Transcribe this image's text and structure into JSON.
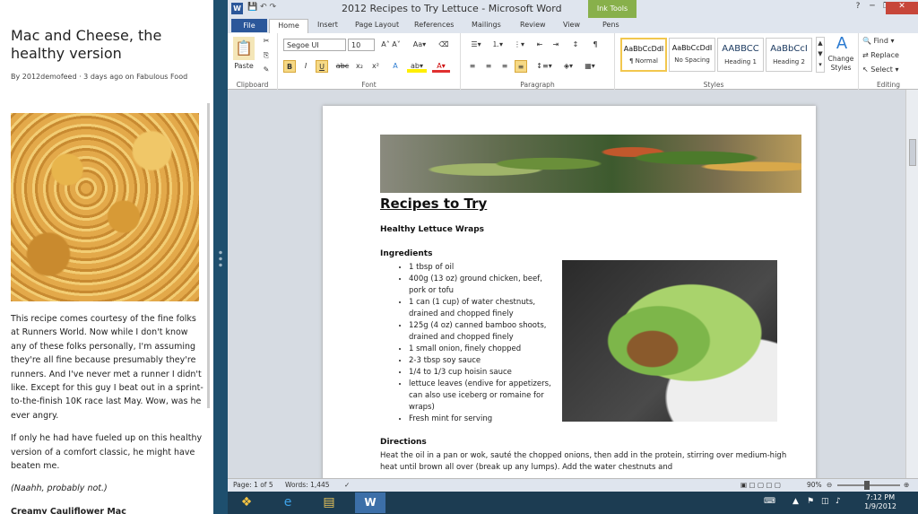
{
  "reader": {
    "title": "Mac and Cheese, the healthy version",
    "byline": "By 2012demofeed · 3 days ago on Fabulous Food",
    "paragraphs": [
      "This recipe comes courtesy of the fine folks at Runners World. Now while I don't know any of these folks personally, I'm assuming they're all fine because presumably they're runners. And I've never met a runner I didn't like. Except for this guy I beat out in a sprint-to-the-finish 10K race last May. Wow, was he ever angry.",
      "If only he had have fueled up on this healthy version of a comfort classic, he might have beaten me.",
      "(Naahh, probably not.)"
    ],
    "subheading": "Creamy Cauliflower Mac"
  },
  "word": {
    "window_title": "2012 Recipes to Try Lettuce - Microsoft Word",
    "contextual_tab": "Ink Tools",
    "tabs": [
      "File",
      "Home",
      "Insert",
      "Page Layout",
      "References",
      "Mailings",
      "Review",
      "View",
      "Pens"
    ],
    "ribbon": {
      "paste_label": "Paste",
      "font_name": "Segoe UI",
      "font_size": "10",
      "groups": [
        "Clipboard",
        "Font",
        "Paragraph",
        "Styles",
        "Editing"
      ],
      "styles": [
        {
          "preview": "AaBbCcDdI",
          "name": "¶ Normal"
        },
        {
          "preview": "AaBbCcDdI",
          "name": "No Spacing"
        },
        {
          "preview": "AABBCC",
          "name": "Heading 1"
        },
        {
          "preview": "AaBbCcI",
          "name": "Heading 2"
        }
      ],
      "change_styles": "Change Styles",
      "find": "Find",
      "replace": "Replace",
      "select": "Select"
    },
    "document": {
      "heading": "Recipes to Try",
      "recipe_title": "Healthy Lettuce Wraps",
      "ingredients_label": "Ingredients",
      "ingredients": [
        "1 tbsp of oil",
        "400g (13 oz) ground chicken, beef, pork or tofu",
        "1 can (1 cup) of water chestnuts, drained and chopped finely",
        "125g (4 oz) canned bamboo shoots, drained and chopped finely",
        "1 small onion, finely chopped",
        "2-3 tbsp soy sauce",
        "1/4 to 1/3 cup hoisin sauce",
        "lettuce leaves (endive for appetizers, can also use iceberg or romaine for wraps)",
        "Fresh mint for serving"
      ],
      "directions_label": "Directions",
      "directions": "Heat the oil in a pan or wok, sauté the chopped onions, then add in the protein, stirring over medium-high heat until brown all over (break up any lumps). Add the water chestnuts and"
    },
    "status": {
      "page": "Page: 1 of 5",
      "words": "Words: 1,445",
      "zoom": "90%"
    }
  },
  "taskbar": {
    "time": "7:12 PM",
    "date": "1/9/2012"
  }
}
